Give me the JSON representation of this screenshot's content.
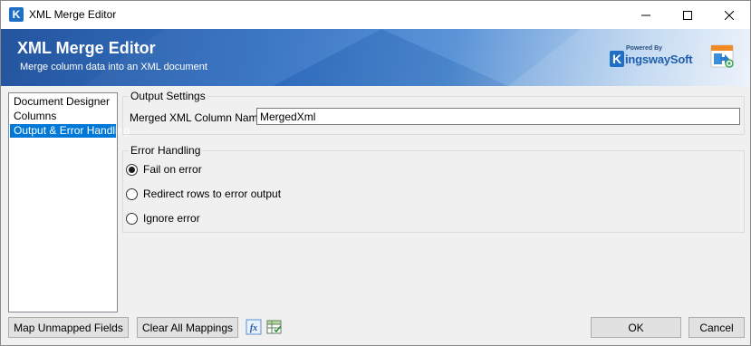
{
  "window": {
    "title": "XML Merge Editor",
    "icon": "kingswaysoft-k-icon",
    "controls": [
      "minimize-icon",
      "maximize-icon",
      "close-icon"
    ]
  },
  "banner": {
    "title": "XML Merge Editor",
    "subtitle": "Merge column data into an XML document",
    "logo_powered": "Powered By",
    "logo_letter": "K",
    "logo_name": "ingswaySoft",
    "component_icon": "xml-merge-component-icon"
  },
  "nav": {
    "items": [
      {
        "label": "Document Designer",
        "selected": false
      },
      {
        "label": "Columns",
        "selected": false
      },
      {
        "label": "Output & Error Handling",
        "selected": true
      }
    ]
  },
  "output_settings": {
    "legend": "Output Settings",
    "column_label": "Merged XML Column Name:",
    "column_value": "MergedXml"
  },
  "error_handling": {
    "legend": "Error Handling",
    "options": [
      {
        "label": "Fail on error",
        "checked": true
      },
      {
        "label": "Redirect rows to error output",
        "checked": false
      },
      {
        "label": "Ignore error",
        "checked": false
      }
    ]
  },
  "footer": {
    "map_unmapped": "Map Unmapped Fields",
    "clear_mappings": "Clear All Mappings",
    "fx_icon": "expression-fx-icon",
    "grid_icon": "variables-grid-icon",
    "ok": "OK",
    "cancel": "Cancel"
  },
  "colors": {
    "selection": "#0078d7",
    "banner_dark": "#1c4f9c",
    "brand_blue": "#1f6fc5"
  }
}
